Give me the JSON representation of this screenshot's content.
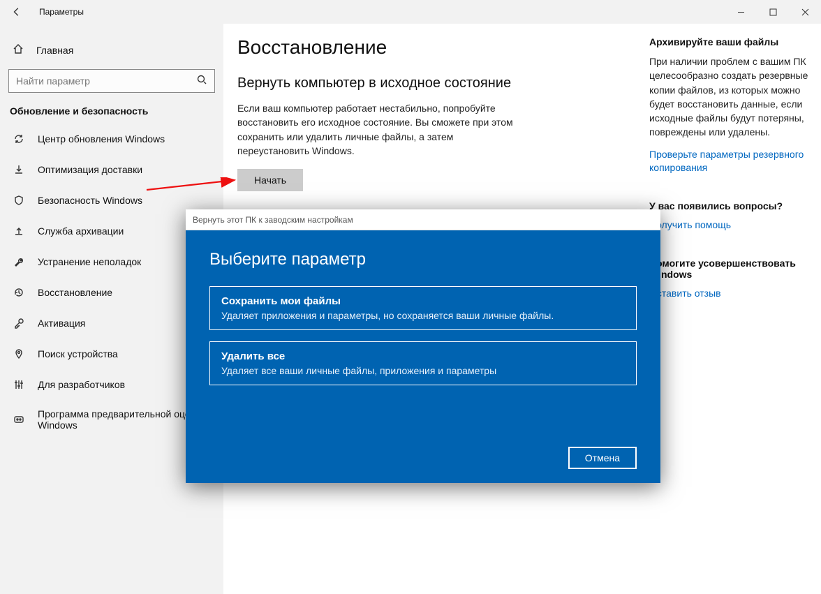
{
  "window": {
    "title": "Параметры"
  },
  "nav": {
    "home": "Главная",
    "search_placeholder": "Найти параметр",
    "section": "Обновление и безопасность",
    "items": [
      "Центр обновления Windows",
      "Оптимизация доставки",
      "Безопасность Windows",
      "Служба архивации",
      "Устранение неполадок",
      "Восстановление",
      "Активация",
      "Поиск устройства",
      "Для разработчиков",
      "Программа предварительной оценки Windows"
    ]
  },
  "main": {
    "page_title": "Восстановление",
    "section_title": "Вернуть компьютер в исходное состояние",
    "body": "Если ваш компьютер работает нестабильно, попробуйте восстановить его исходное состояние. Вы сможете при этом сохранить или удалить личные файлы, а затем переустановить Windows.",
    "start_button": "Начать"
  },
  "right": {
    "h1": "Архивируйте ваши файлы",
    "p1": "При наличии проблем с вашим ПК целесообразно создать резервные копии файлов, из которых можно будет восстановить данные, если исходные файлы будут потеряны, повреждены или удалены.",
    "link1": "Проверьте параметры резервного копирования",
    "h2": "У вас появились вопросы?",
    "link2": "Получить помощь",
    "h3": "Помогите усовершенствовать Windows",
    "link3": "Оставить отзыв"
  },
  "modal": {
    "titlebar": "Вернуть этот ПК к заводским настройкам",
    "heading": "Выберите параметр",
    "opt1_title": "Сохранить мои файлы",
    "opt1_desc": "Удаляет приложения и параметры, но сохраняется ваши личные файлы.",
    "opt2_title": "Удалить все",
    "opt2_desc": "Удаляет все ваши личные файлы, приложения и параметры",
    "cancel": "Отмена"
  }
}
